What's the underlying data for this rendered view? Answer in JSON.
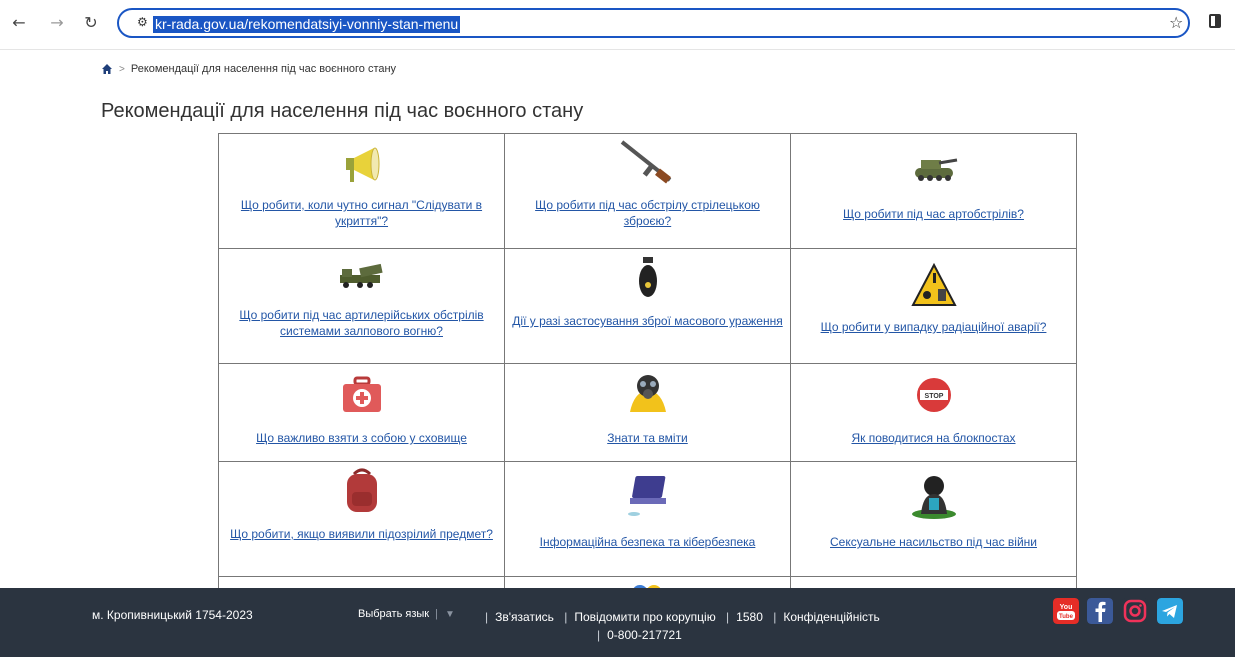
{
  "browser": {
    "back_icon": "back-arrow-icon",
    "forward_icon": "forward-arrow-icon",
    "reload_icon": "reload-icon",
    "url": "kr-rada.gov.ua/rekomendatsiyi-vonniy-stan-menu"
  },
  "breadcrumb": {
    "current": "Рекомендації для населення під час воєнного стану"
  },
  "page": {
    "title": "Рекомендації для населення під час воєнного стану"
  },
  "cards": [
    {
      "icon": "megaphone-icon",
      "label": "Що робити, коли чутно сигнал \"Слідувати в укриття\"?"
    },
    {
      "icon": "rifle-icon",
      "label": "Що робити під час обстрілу стрілецькою зброєю?"
    },
    {
      "icon": "tank-icon",
      "label": "Що робити під час артобстрілів?"
    },
    {
      "icon": "rocket-launcher-icon",
      "label": "Що робити під час артилерійських обстрілів системами залпового вогню?"
    },
    {
      "icon": "nuclear-bomb-icon",
      "label": "Дії у разі застосування зброї масового ураження"
    },
    {
      "icon": "radiation-sign-icon",
      "label": "Що робити у випадку радіаційної аварії?"
    },
    {
      "icon": "first-aid-kit-icon",
      "label": "Що важливо взяти з собою у сховище"
    },
    {
      "icon": "gas-mask-icon",
      "label": "Знати та вміти"
    },
    {
      "icon": "stop-sign-icon",
      "label": "Як поводитися на блокпостах"
    },
    {
      "icon": "backpack-icon",
      "label": "Що робити, якщо виявили підозрілий предмет?"
    },
    {
      "icon": "laptop-icon",
      "label": "Інформаційна безпека та кібербезпека"
    },
    {
      "icon": "crying-person-icon",
      "label": "Сексуальне насильство під час війни"
    }
  ],
  "footer": {
    "city": "м. Кропивницький 1754-2023",
    "language": "Выбрать язык",
    "contact": "Зв'язатись",
    "corruption": "Повідомити про корупцію",
    "hotline": "1580",
    "privacy": "Конфіденційність",
    "phone": "0-800-217721",
    "social": [
      "youtube-icon",
      "facebook-icon",
      "instagram-icon",
      "telegram-icon"
    ],
    "colors": {
      "background": "#2b3440",
      "youtube": "#e52d27",
      "facebook": "#3b5998",
      "telegram": "#2ca5e0"
    }
  }
}
